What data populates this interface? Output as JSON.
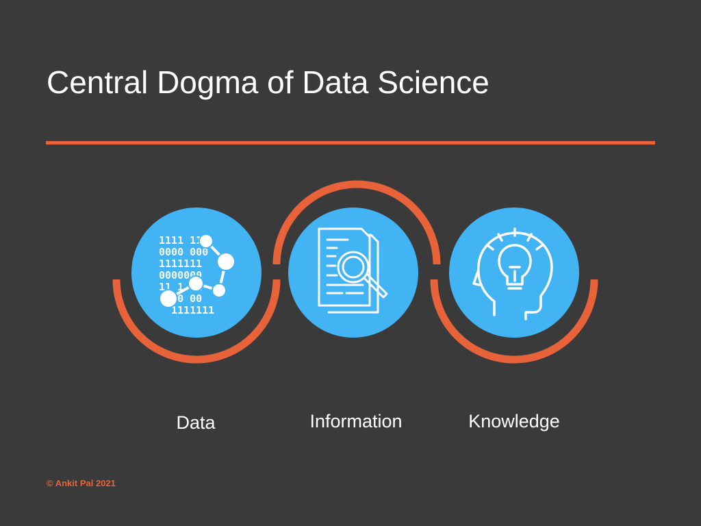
{
  "title": "Central Dogma of Data Science",
  "stages": [
    {
      "label": "Data",
      "icon": "binary-data-network-icon"
    },
    {
      "label": "Information",
      "icon": "document-search-icon"
    },
    {
      "label": "Knowledge",
      "icon": "head-lightbulb-icon"
    }
  ],
  "data_icon": {
    "rows": [
      "1111 111",
      "0000 000",
      "1111111",
      "0000000",
      "11 1 11",
      "00 0 00",
      "1111111"
    ]
  },
  "copyright": "© Ankit Pal 2021",
  "colors": {
    "background": "#3a3a3a",
    "accent": "#e8623a",
    "circle": "#42b4f4",
    "icon": "#ffffff",
    "text": "#ffffff"
  }
}
